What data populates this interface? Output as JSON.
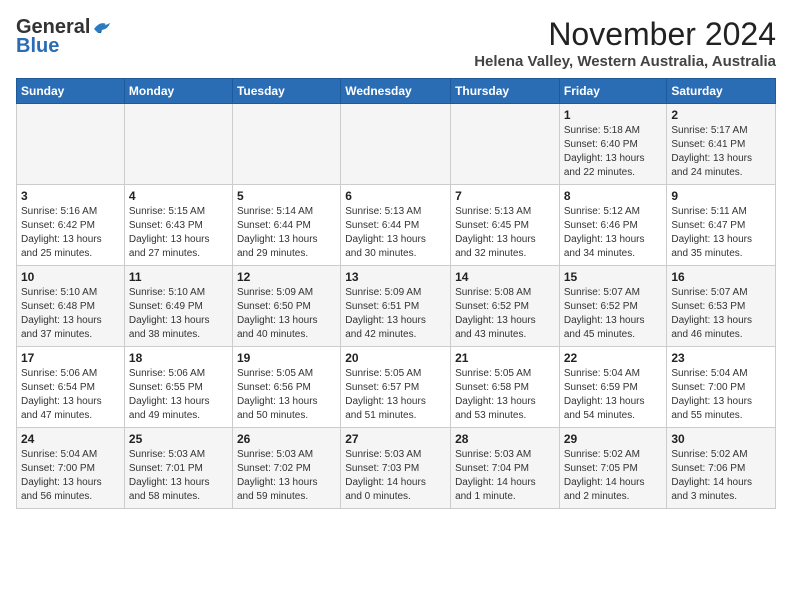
{
  "header": {
    "logo_line1": "General",
    "logo_line2": "Blue",
    "month_title": "November 2024",
    "location": "Helena Valley, Western Australia, Australia"
  },
  "weekdays": [
    "Sunday",
    "Monday",
    "Tuesday",
    "Wednesday",
    "Thursday",
    "Friday",
    "Saturday"
  ],
  "weeks": [
    [
      {
        "day": "",
        "info": ""
      },
      {
        "day": "",
        "info": ""
      },
      {
        "day": "",
        "info": ""
      },
      {
        "day": "",
        "info": ""
      },
      {
        "day": "",
        "info": ""
      },
      {
        "day": "1",
        "info": "Sunrise: 5:18 AM\nSunset: 6:40 PM\nDaylight: 13 hours\nand 22 minutes."
      },
      {
        "day": "2",
        "info": "Sunrise: 5:17 AM\nSunset: 6:41 PM\nDaylight: 13 hours\nand 24 minutes."
      }
    ],
    [
      {
        "day": "3",
        "info": "Sunrise: 5:16 AM\nSunset: 6:42 PM\nDaylight: 13 hours\nand 25 minutes."
      },
      {
        "day": "4",
        "info": "Sunrise: 5:15 AM\nSunset: 6:43 PM\nDaylight: 13 hours\nand 27 minutes."
      },
      {
        "day": "5",
        "info": "Sunrise: 5:14 AM\nSunset: 6:44 PM\nDaylight: 13 hours\nand 29 minutes."
      },
      {
        "day": "6",
        "info": "Sunrise: 5:13 AM\nSunset: 6:44 PM\nDaylight: 13 hours\nand 30 minutes."
      },
      {
        "day": "7",
        "info": "Sunrise: 5:13 AM\nSunset: 6:45 PM\nDaylight: 13 hours\nand 32 minutes."
      },
      {
        "day": "8",
        "info": "Sunrise: 5:12 AM\nSunset: 6:46 PM\nDaylight: 13 hours\nand 34 minutes."
      },
      {
        "day": "9",
        "info": "Sunrise: 5:11 AM\nSunset: 6:47 PM\nDaylight: 13 hours\nand 35 minutes."
      }
    ],
    [
      {
        "day": "10",
        "info": "Sunrise: 5:10 AM\nSunset: 6:48 PM\nDaylight: 13 hours\nand 37 minutes."
      },
      {
        "day": "11",
        "info": "Sunrise: 5:10 AM\nSunset: 6:49 PM\nDaylight: 13 hours\nand 38 minutes."
      },
      {
        "day": "12",
        "info": "Sunrise: 5:09 AM\nSunset: 6:50 PM\nDaylight: 13 hours\nand 40 minutes."
      },
      {
        "day": "13",
        "info": "Sunrise: 5:09 AM\nSunset: 6:51 PM\nDaylight: 13 hours\nand 42 minutes."
      },
      {
        "day": "14",
        "info": "Sunrise: 5:08 AM\nSunset: 6:52 PM\nDaylight: 13 hours\nand 43 minutes."
      },
      {
        "day": "15",
        "info": "Sunrise: 5:07 AM\nSunset: 6:52 PM\nDaylight: 13 hours\nand 45 minutes."
      },
      {
        "day": "16",
        "info": "Sunrise: 5:07 AM\nSunset: 6:53 PM\nDaylight: 13 hours\nand 46 minutes."
      }
    ],
    [
      {
        "day": "17",
        "info": "Sunrise: 5:06 AM\nSunset: 6:54 PM\nDaylight: 13 hours\nand 47 minutes."
      },
      {
        "day": "18",
        "info": "Sunrise: 5:06 AM\nSunset: 6:55 PM\nDaylight: 13 hours\nand 49 minutes."
      },
      {
        "day": "19",
        "info": "Sunrise: 5:05 AM\nSunset: 6:56 PM\nDaylight: 13 hours\nand 50 minutes."
      },
      {
        "day": "20",
        "info": "Sunrise: 5:05 AM\nSunset: 6:57 PM\nDaylight: 13 hours\nand 51 minutes."
      },
      {
        "day": "21",
        "info": "Sunrise: 5:05 AM\nSunset: 6:58 PM\nDaylight: 13 hours\nand 53 minutes."
      },
      {
        "day": "22",
        "info": "Sunrise: 5:04 AM\nSunset: 6:59 PM\nDaylight: 13 hours\nand 54 minutes."
      },
      {
        "day": "23",
        "info": "Sunrise: 5:04 AM\nSunset: 7:00 PM\nDaylight: 13 hours\nand 55 minutes."
      }
    ],
    [
      {
        "day": "24",
        "info": "Sunrise: 5:04 AM\nSunset: 7:00 PM\nDaylight: 13 hours\nand 56 minutes."
      },
      {
        "day": "25",
        "info": "Sunrise: 5:03 AM\nSunset: 7:01 PM\nDaylight: 13 hours\nand 58 minutes."
      },
      {
        "day": "26",
        "info": "Sunrise: 5:03 AM\nSunset: 7:02 PM\nDaylight: 13 hours\nand 59 minutes."
      },
      {
        "day": "27",
        "info": "Sunrise: 5:03 AM\nSunset: 7:03 PM\nDaylight: 14 hours\nand 0 minutes."
      },
      {
        "day": "28",
        "info": "Sunrise: 5:03 AM\nSunset: 7:04 PM\nDaylight: 14 hours\nand 1 minute."
      },
      {
        "day": "29",
        "info": "Sunrise: 5:02 AM\nSunset: 7:05 PM\nDaylight: 14 hours\nand 2 minutes."
      },
      {
        "day": "30",
        "info": "Sunrise: 5:02 AM\nSunset: 7:06 PM\nDaylight: 14 hours\nand 3 minutes."
      }
    ]
  ]
}
